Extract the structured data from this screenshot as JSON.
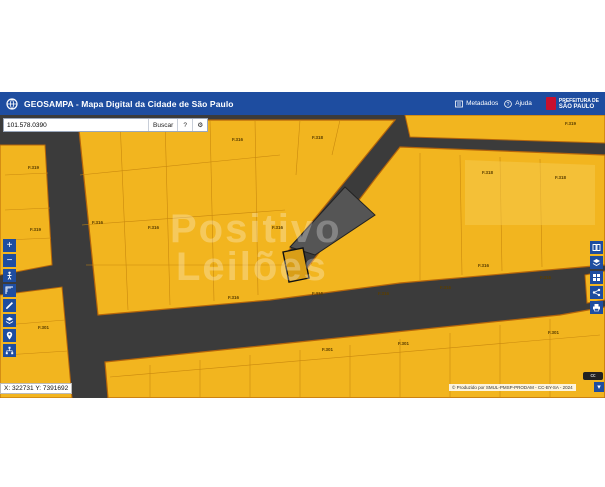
{
  "header": {
    "title": "GEOSAMPA - Mapa Digital da Cidade de São Paulo",
    "metadados_label": "Metadados",
    "ajuda_label": "Ajuda",
    "prefeitura_line1": "PREFEITURA DE",
    "prefeitura_line2": "SÃO PAULO"
  },
  "search": {
    "value": "101.578.0390",
    "button_label": "Buscar",
    "help_icon": "?",
    "settings_icon": "⚙"
  },
  "left_toolbar": [
    "zoom-in-icon",
    "zoom-out-icon",
    "person-icon",
    "measure-icon",
    "draw-icon",
    "layers-icon",
    "location-pin-icon",
    "network-icon"
  ],
  "right_toolbar": [
    "book-icon",
    "layers-icon",
    "grid-icon",
    "share-icon",
    "print-icon"
  ],
  "coordinates": "X: 322731 Y: 7391692",
  "attribution": "© Produzido por SMUL-PMSP-PRODAM - CC-BY-SA - 2024",
  "cc_badge": "cc",
  "watermark": {
    "line1": "Positivo",
    "line2": "Leilões"
  },
  "lot_labels": [
    {
      "text": "F.319"
    },
    {
      "text": "F.318"
    },
    {
      "text": "F.316"
    },
    {
      "text": "F.316"
    },
    {
      "text": "F.316"
    },
    {
      "text": "F.316"
    },
    {
      "text": "F.316"
    },
    {
      "text": "F.316"
    },
    {
      "text": "F.318"
    },
    {
      "text": "F.318"
    },
    {
      "text": "F.319"
    },
    {
      "text": "F.319"
    },
    {
      "text": "F.316"
    },
    {
      "text": "F.316"
    },
    {
      "text": "F.301"
    },
    {
      "text": "F.301"
    },
    {
      "text": "F.301"
    },
    {
      "text": "F.316"
    },
    {
      "text": "F.316"
    },
    {
      "text": "F.301"
    }
  ],
  "colors": {
    "header_bg": "#1e4da0",
    "lot_fill": "#f2b51f",
    "lot_border": "#b5650a",
    "street": "#3a3a3a"
  }
}
